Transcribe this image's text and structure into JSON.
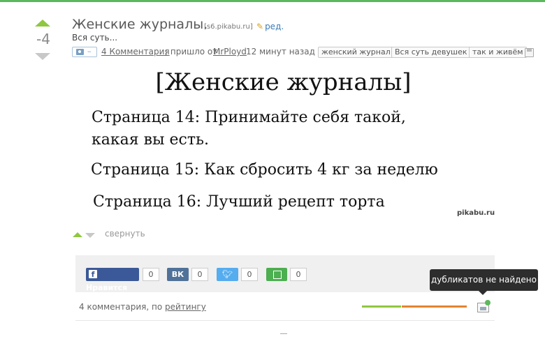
{
  "post": {
    "score": "-4",
    "title": "Женские журналы.",
    "source": "[s6.pikabu.ru]",
    "edit_label": "ред.",
    "description": "Вся суть...",
    "camera_label": "–",
    "comments_link": "4 Комментария",
    "from_text": "; пришло от",
    "author": "MrPloyd",
    "time": "12 минут назад",
    "tags": [
      "женский журнал",
      "Вся суть девушек",
      "так и живём"
    ]
  },
  "image": {
    "title": "[Женские журналы]",
    "lines": [
      "Страница 14: Принимайте себя такой,",
      "какая вы есть.",
      "Страница 15: Как сбросить 4 кг за неделю",
      "Страница 16: Лучший рецепт торта"
    ],
    "watermark": "pikabu.ru"
  },
  "actions": {
    "collapse_label": "свернуть"
  },
  "share": {
    "facebook_label": "Нравится",
    "facebook_count": "0",
    "vk_label": "ВК",
    "vk_count": "0",
    "twitter_count": "0",
    "save_count": "0"
  },
  "comments": {
    "count_text": "4 комментария, по ",
    "sort_label": "рейтингу"
  },
  "tooltip": {
    "text": "дубликатов не найдено"
  },
  "colors": {
    "accent_green": "#8fc740",
    "accent_orange": "#e38330",
    "link_blue": "#3a7ab7"
  }
}
